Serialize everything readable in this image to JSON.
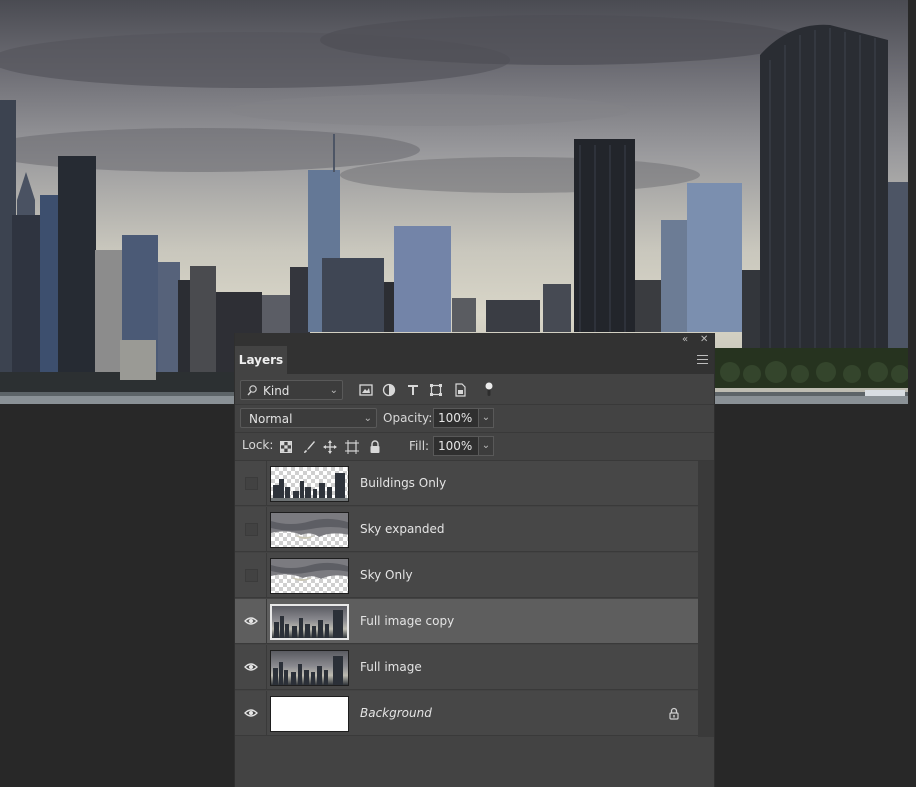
{
  "panel": {
    "tab_label": "Layers",
    "collapse_glyph": "«",
    "close_glyph": "✕",
    "menu_icon": "panel-menu-icon"
  },
  "filter": {
    "kind_label": "Kind",
    "kind_icon": "search-icon",
    "filter_icons": [
      "image-filter-icon",
      "adjustment-filter-icon",
      "type-filter-icon",
      "shape-filter-icon",
      "smart-object-filter-icon",
      "filter-toggle-icon"
    ]
  },
  "blend": {
    "mode": "Normal",
    "opacity_label": "Opacity:",
    "opacity_value": "100%"
  },
  "lock": {
    "label": "Lock:",
    "lock_icons": [
      "lock-transparency-icon",
      "lock-image-icon",
      "lock-position-icon",
      "lock-artboard-icon",
      "lock-all-icon"
    ],
    "fill_label": "Fill:",
    "fill_value": "100%"
  },
  "layers": [
    {
      "name": "Buildings Only",
      "visible": false,
      "thumb": "buildings-transparent",
      "selected": false,
      "locked": false,
      "italic": false
    },
    {
      "name": "Sky expanded",
      "visible": false,
      "thumb": "sky-transparent",
      "selected": false,
      "locked": false,
      "italic": false
    },
    {
      "name": "Sky Only",
      "visible": false,
      "thumb": "sky-transparent",
      "selected": false,
      "locked": false,
      "italic": false
    },
    {
      "name": "Full image copy",
      "visible": true,
      "thumb": "full",
      "selected": true,
      "locked": false,
      "italic": false
    },
    {
      "name": "Full image",
      "visible": true,
      "thumb": "full",
      "selected": false,
      "locked": false,
      "italic": false
    },
    {
      "name": "Background",
      "visible": true,
      "thumb": "white",
      "selected": false,
      "locked": true,
      "italic": true
    }
  ],
  "colors": {
    "panel_bg": "#434343",
    "selected_row": "#5e5e5e",
    "workspace_bg": "#282828"
  }
}
